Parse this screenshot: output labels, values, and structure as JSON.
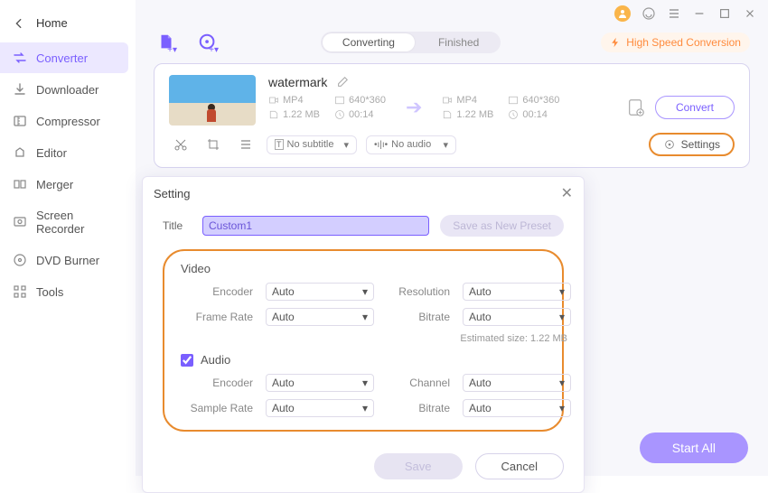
{
  "home_label": "Home",
  "sidebar": {
    "items": [
      {
        "label": "Converter"
      },
      {
        "label": "Downloader"
      },
      {
        "label": "Compressor"
      },
      {
        "label": "Editor"
      },
      {
        "label": "Merger"
      },
      {
        "label": "Screen Recorder"
      },
      {
        "label": "DVD Burner"
      },
      {
        "label": "Tools"
      }
    ]
  },
  "tabs": {
    "converting": "Converting",
    "finished": "Finished"
  },
  "hsc_label": "High Speed Conversion",
  "item": {
    "title": "watermark",
    "src": {
      "format": "MP4",
      "resolution": "640*360",
      "size": "1.22 MB",
      "duration": "00:14"
    },
    "dst": {
      "format": "MP4",
      "resolution": "640*360",
      "size": "1.22 MB",
      "duration": "00:14"
    },
    "subtitle_dd": "No subtitle",
    "audio_dd": "No audio",
    "settings_label": "Settings",
    "convert_label": "Convert"
  },
  "start_all": "Start All",
  "modal": {
    "header": "Setting",
    "title_label": "Title",
    "title_value": "Custom1",
    "save_preset": "Save as New Preset",
    "video": {
      "heading": "Video",
      "encoder_label": "Encoder",
      "encoder_value": "Auto",
      "resolution_label": "Resolution",
      "resolution_value": "Auto",
      "framerate_label": "Frame Rate",
      "framerate_value": "Auto",
      "bitrate_label": "Bitrate",
      "bitrate_value": "Auto",
      "estimated": "Estimated size: 1.22 MB"
    },
    "audio": {
      "heading": "Audio",
      "encoder_label": "Encoder",
      "encoder_value": "Auto",
      "channel_label": "Channel",
      "channel_value": "Auto",
      "samplerate_label": "Sample Rate",
      "samplerate_value": "Auto",
      "bitrate_label": "Bitrate",
      "bitrate_value": "Auto"
    },
    "save_btn": "Save",
    "cancel_btn": "Cancel"
  }
}
